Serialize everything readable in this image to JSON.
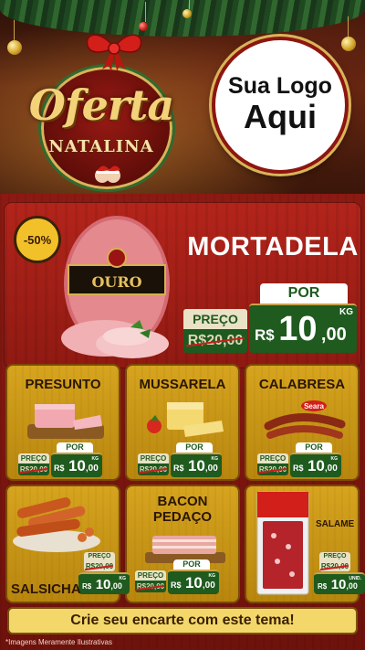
{
  "header": {
    "badge_script": "Oferta",
    "badge_subtitle": "NATALINA",
    "logo_line1": "Sua Logo",
    "logo_line2": "Aqui"
  },
  "hero": {
    "discount": "-50%",
    "title": "MORTADELA",
    "brand_label": "OURO",
    "preco_label": "PREÇO",
    "old_price": "R$20,00",
    "por_label": "POR",
    "currency": "R$",
    "price_int": "10",
    "price_cents": ",00",
    "unit": "KG"
  },
  "products": [
    {
      "name": "PRESUNTO",
      "preco_label": "PREÇO",
      "old_price": "R$20,00",
      "por_label": "POR",
      "currency": "R$",
      "price_int": "10",
      "price_cents": ",00",
      "unit": "KG"
    },
    {
      "name": "MUSSARELA",
      "preco_label": "PREÇO",
      "old_price": "R$20,00",
      "por_label": "POR",
      "currency": "R$",
      "price_int": "10",
      "price_cents": ",00",
      "unit": "KG"
    },
    {
      "name": "CALABRESA",
      "brand": "Seara",
      "preco_label": "PREÇO",
      "old_price": "R$20,00",
      "por_label": "POR",
      "currency": "R$",
      "price_int": "10",
      "price_cents": ",00",
      "unit": "KG"
    },
    {
      "name": "SALSICHA",
      "preco_label": "PREÇO",
      "old_price": "R$20,00",
      "por_label": "POR",
      "currency": "R$",
      "price_int": "10",
      "price_cents": ",00",
      "unit": "KG"
    },
    {
      "name": "BACON\nPEDAÇO",
      "name_line1": "BACON",
      "name_line2": "PEDAÇO",
      "preco_label": "PREÇO",
      "old_price": "R$20,00",
      "por_label": "POR",
      "currency": "R$",
      "price_int": "10",
      "price_cents": ",00",
      "unit": "KG"
    },
    {
      "name": "SALAME",
      "preco_label": "PREÇO",
      "old_price": "R$20,00",
      "por_label": "POR",
      "currency": "R$",
      "price_int": "10",
      "price_cents": ",00",
      "unit": "UNID."
    }
  ],
  "footer": {
    "cta": "Crie seu encarte com este tema!",
    "note": "*Imagens Meramente Ilustrativas"
  },
  "colors": {
    "board_red": "#8b1a12",
    "card_gold": "#d6a41e",
    "price_green": "#1f5a1e",
    "banner_yellow": "#f3d76b"
  }
}
